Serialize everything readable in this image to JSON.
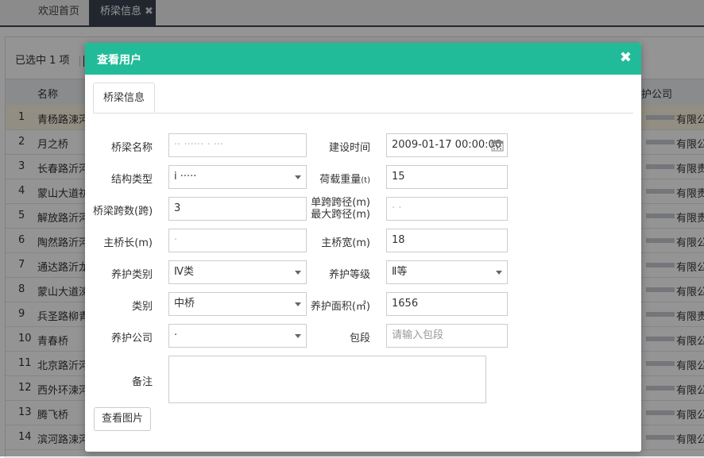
{
  "tabs": {
    "home": "欢迎首页",
    "active": "桥梁信息",
    "close_glyph": "✖"
  },
  "page": {
    "selected": "已选中  1 项",
    "col_name": "名称",
    "col_company": "护公司",
    "rows": [
      {
        "no": "1",
        "name": "青杨路涑河",
        "company": "有限公司"
      },
      {
        "no": "2",
        "name": "月之桥",
        "company": "有限公司"
      },
      {
        "no": "3",
        "name": "长春路沂河",
        "company": "有限责"
      },
      {
        "no": "4",
        "name": "蒙山大道祊",
        "company": "有限责"
      },
      {
        "no": "5",
        "name": "解放路沂河",
        "company": "有限责"
      },
      {
        "no": "6",
        "name": "陶然路沂河",
        "company": "有限公"
      },
      {
        "no": "7",
        "name": "通达路沂龙",
        "company": "有限公"
      },
      {
        "no": "8",
        "name": "蒙山大道涑",
        "company": "有限公"
      },
      {
        "no": "9",
        "name": "兵圣路柳青",
        "company": "有限责"
      },
      {
        "no": "10",
        "name": "青春桥",
        "company": "有限公"
      },
      {
        "no": "11",
        "name": "北京路沂河",
        "company": "有限公"
      },
      {
        "no": "12",
        "name": "西外环涑河",
        "company": "有限公"
      },
      {
        "no": "13",
        "name": "腾飞桥",
        "company": "有限公"
      },
      {
        "no": "14",
        "name": "滨河路涑河",
        "company": "有限公"
      }
    ]
  },
  "modal": {
    "title": "查看用户",
    "close_glyph": "✖",
    "tab": "桥梁信息",
    "fields": {
      "bridge_name": {
        "label": "桥梁名称",
        "value": "·· ······ · ···"
      },
      "build_time": {
        "label": "建设时间",
        "value": "2009-01-17 00:00:00"
      },
      "struct_type": {
        "label": "结构类型",
        "value": "i ·····"
      },
      "load_weight": {
        "label": "荷载重量",
        "unit": "(t)",
        "value": "15"
      },
      "spans": {
        "label": "桥梁跨数(跨)",
        "value": "3"
      },
      "single_span": {
        "label": "单跨跨径(m)",
        "label2": "最大跨径(m)",
        "value": "· ·"
      },
      "main_len": {
        "label": "主桥长(m)",
        "value": "·"
      },
      "main_width": {
        "label": "主桥宽(m)",
        "value": "18"
      },
      "maint_type": {
        "label": "养护类别",
        "value": "Ⅳ类"
      },
      "maint_level": {
        "label": "养护等级",
        "value": "Ⅱ等"
      },
      "category": {
        "label": "类别",
        "value": "中桥"
      },
      "maint_area": {
        "label": "养护面积(㎡)",
        "value": "1656"
      },
      "maint_company": {
        "label": "养护公司",
        "value": "·"
      },
      "section": {
        "label": "包段",
        "placeholder": "请输入包段"
      },
      "remark": {
        "label": "备注",
        "value": ""
      }
    },
    "view_images_button": "查看图片"
  }
}
